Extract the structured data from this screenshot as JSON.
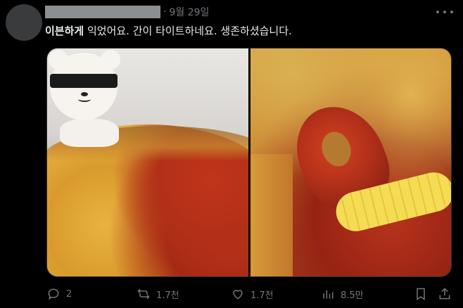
{
  "post": {
    "author_name_redacted": true,
    "separator": "·",
    "time": "9월 29일",
    "text_bold": "이븐하게",
    "text_rest": " 익었어요. 간이 타이트하네요. 생존하셨습니다."
  },
  "media": {
    "photos": [
      {
        "description_icon": "pizza-photo-with-plush"
      },
      {
        "description_icon": "pizza-closeup-shrimp-corn"
      }
    ]
  },
  "actions": {
    "reply_count": "2",
    "repost_count": "1.7천",
    "like_count": "1.7천",
    "view_count": "8.5만"
  },
  "colors": {
    "background": "#000000",
    "text": "#e7e9ea",
    "secondary": "#71767b"
  }
}
